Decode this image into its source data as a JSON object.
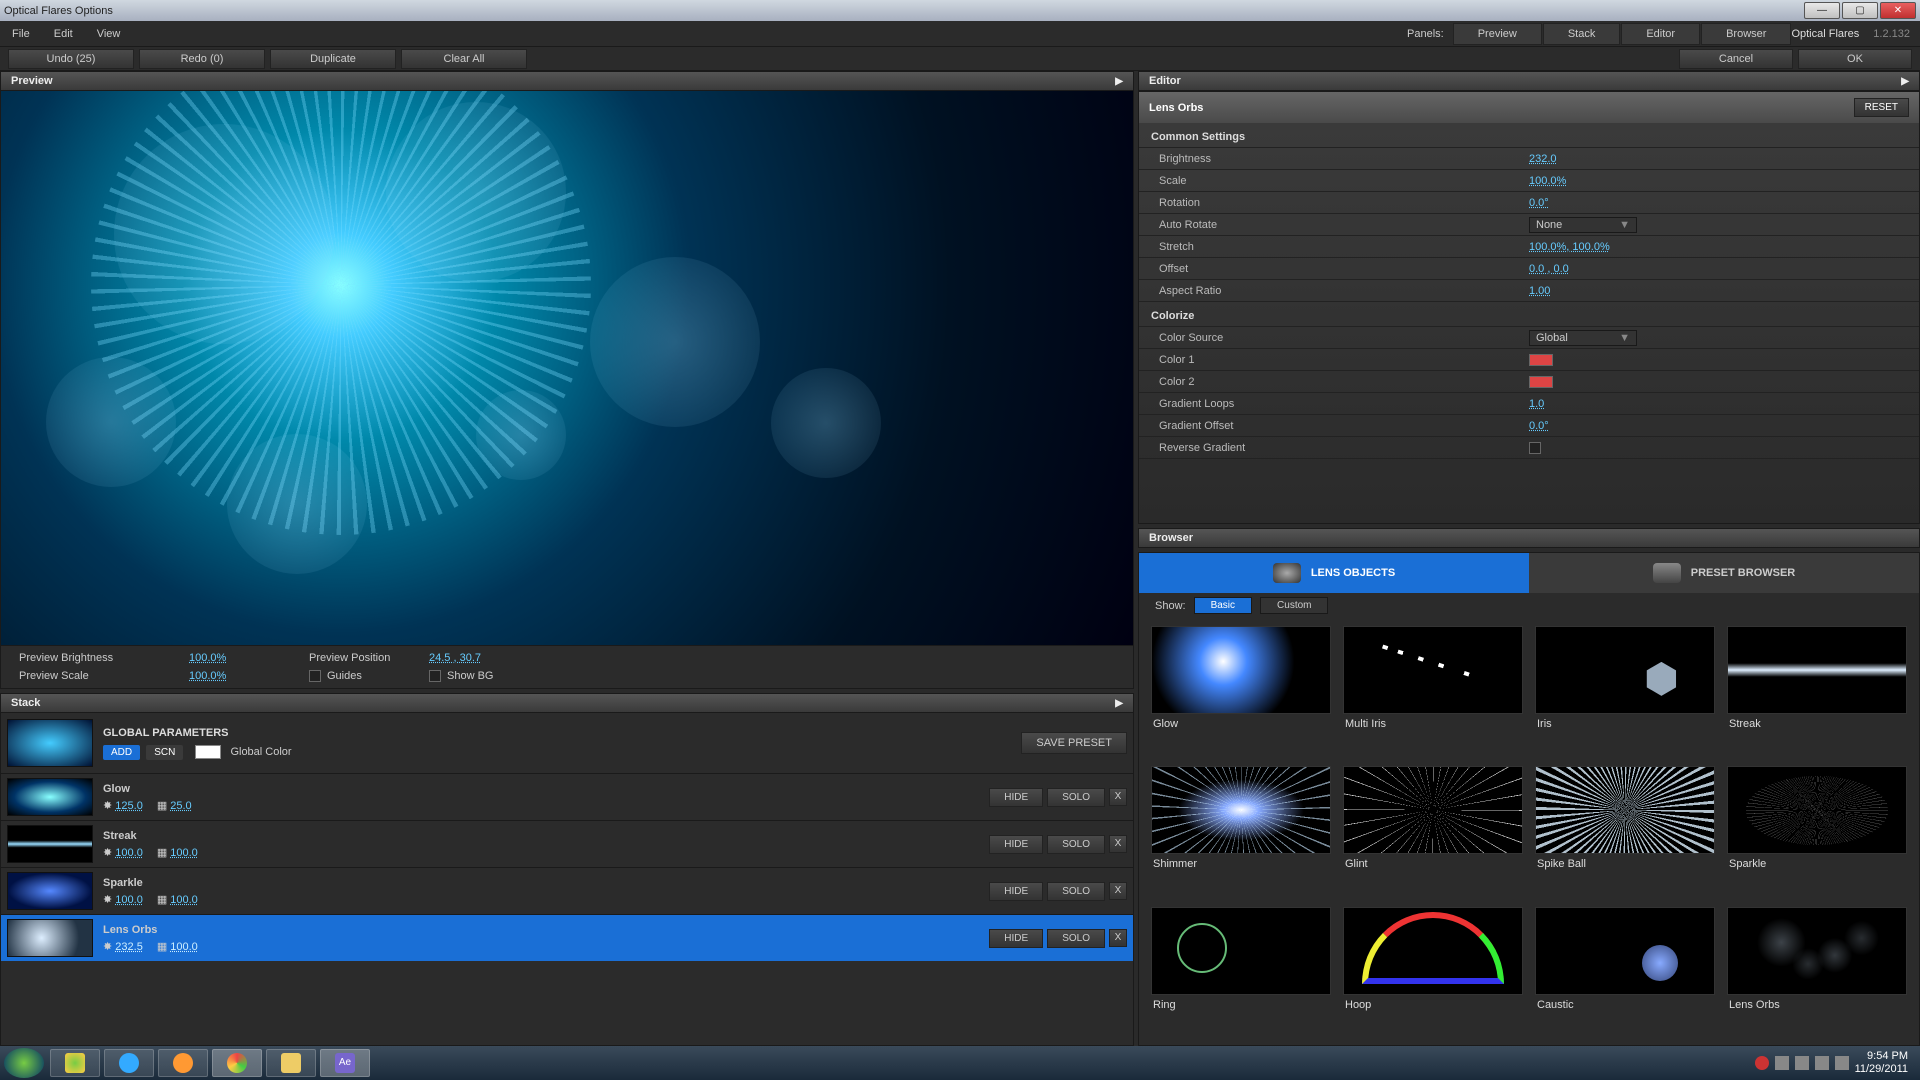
{
  "window": {
    "title": "Optical Flares Options"
  },
  "product": {
    "name": "Optical Flares",
    "version": "1.2.132"
  },
  "menus": {
    "file": "File",
    "edit": "Edit",
    "view": "View"
  },
  "panels": {
    "label": "Panels:",
    "preview": "Preview",
    "stack": "Stack",
    "editor": "Editor",
    "browser": "Browser"
  },
  "toolbar": {
    "undo": "Undo (25)",
    "redo": "Redo (0)",
    "duplicate": "Duplicate",
    "clear": "Clear All",
    "cancel": "Cancel",
    "ok": "OK"
  },
  "preview": {
    "title": "Preview",
    "brightness_label": "Preview Brightness",
    "brightness_value": "100.0%",
    "position_label": "Preview Position",
    "position_value": "24.5 , 30.7",
    "scale_label": "Preview Scale",
    "scale_value": "100.0%",
    "guides_label": "Guides",
    "showbg_label": "Show BG"
  },
  "stack": {
    "title": "Stack",
    "global_title": "GLOBAL PARAMETERS",
    "add": "ADD",
    "scn": "SCN",
    "global_color": "Global Color",
    "save_preset": "SAVE PRESET",
    "hide": "HIDE",
    "solo": "SOLO",
    "items": [
      {
        "name": "Glow",
        "v1": "125.0",
        "v2": "25.0"
      },
      {
        "name": "Streak",
        "v1": "100.0",
        "v2": "100.0"
      },
      {
        "name": "Sparkle",
        "v1": "100.0",
        "v2": "100.0"
      },
      {
        "name": "Lens Orbs",
        "v1": "232.5",
        "v2": "100.0"
      }
    ]
  },
  "editor": {
    "title": "Editor",
    "element": "Lens Orbs",
    "reset": "RESET",
    "sections": {
      "common": "Common Settings",
      "colorize": "Colorize"
    },
    "props": {
      "brightness": {
        "label": "Brightness",
        "value": "232.0"
      },
      "scale": {
        "label": "Scale",
        "value": "100.0%"
      },
      "rotation": {
        "label": "Rotation",
        "value": "0.0°"
      },
      "auto_rotate": {
        "label": "Auto Rotate",
        "value": "None"
      },
      "stretch": {
        "label": "Stretch",
        "value": "100.0%, 100.0%"
      },
      "offset": {
        "label": "Offset",
        "value": "0.0 , 0.0"
      },
      "aspect": {
        "label": "Aspect Ratio",
        "value": "1.00"
      },
      "color_source": {
        "label": "Color Source",
        "value": "Global"
      },
      "color1": {
        "label": "Color 1"
      },
      "color2": {
        "label": "Color 2"
      },
      "grad_loops": {
        "label": "Gradient Loops",
        "value": "1.0"
      },
      "grad_offset": {
        "label": "Gradient Offset",
        "value": "0.0°"
      },
      "reverse": {
        "label": "Reverse Gradient"
      }
    }
  },
  "browser": {
    "title": "Browser",
    "tab_objects": "LENS OBJECTS",
    "tab_presets": "PRESET BROWSER",
    "show_label": "Show:",
    "basic": "Basic",
    "custom": "Custom",
    "items": [
      {
        "label": "Glow"
      },
      {
        "label": "Multi Iris"
      },
      {
        "label": "Iris"
      },
      {
        "label": "Streak"
      },
      {
        "label": "Shimmer"
      },
      {
        "label": "Glint"
      },
      {
        "label": "Spike Ball"
      },
      {
        "label": "Sparkle"
      },
      {
        "label": "Ring"
      },
      {
        "label": "Hoop"
      },
      {
        "label": "Caustic"
      },
      {
        "label": "Lens Orbs"
      }
    ]
  },
  "taskbar": {
    "time": "9:54 PM",
    "date": "11/29/2011"
  }
}
